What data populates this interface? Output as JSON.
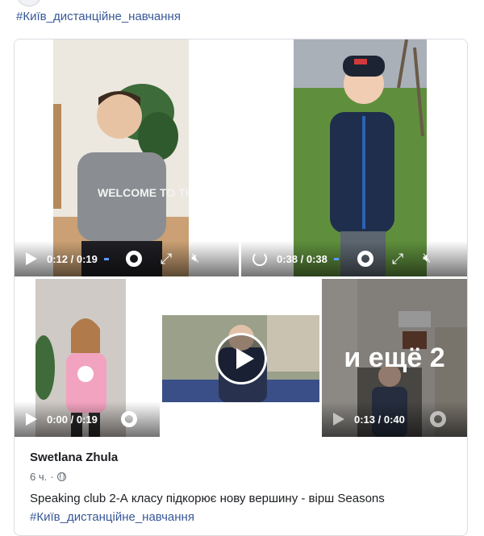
{
  "post": {
    "top_hashtag": "#Київ_дистанційне_навчання",
    "author": "Swetlana Zhula",
    "time": "6 ч.",
    "separator": "·",
    "caption": "Speaking club 2-А класу підкорює нову вершину - вірш Seasons",
    "hashtag": "#Київ_дистанційне_навчання"
  },
  "videos": [
    {
      "time": "0:12 / 0:19",
      "state": "paused",
      "shirt_text": "WELCOME TO THE ..."
    },
    {
      "time": "0:38 / 0:38",
      "state": "ended"
    },
    {
      "time": "0:00 / 0:19",
      "state": "paused"
    },
    {
      "time": "",
      "state": "not-started"
    },
    {
      "time": "0:13 / 0:40",
      "state": "paused",
      "more_label": "и ещё 2"
    }
  ],
  "colors": {
    "link": "#385898",
    "progress": "#5b9bff",
    "border": "#d9dce1"
  },
  "icons": {
    "play": "play-icon",
    "replay": "replay-icon",
    "settings": "gear-icon",
    "fullscreen": "expand-icon",
    "mute": "mute-icon",
    "privacy": "globe-icon"
  }
}
